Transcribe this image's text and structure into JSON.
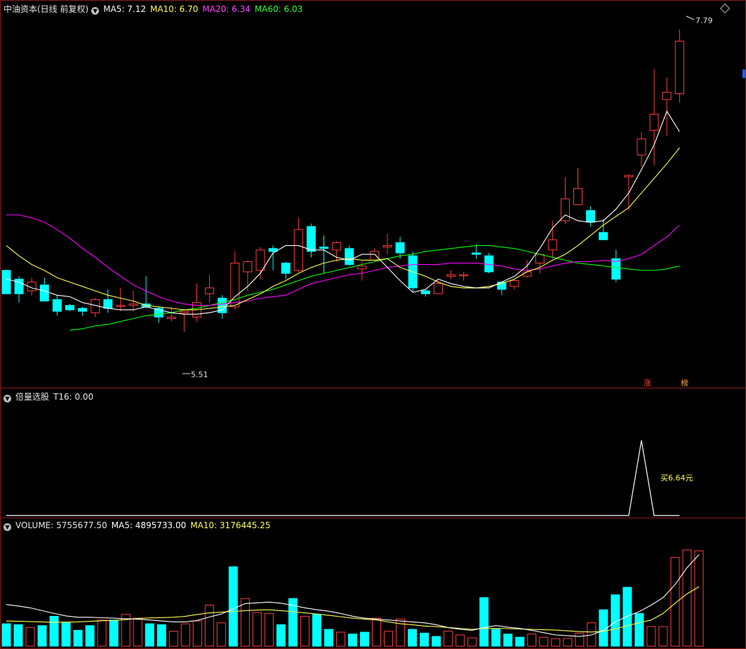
{
  "main_header": {
    "title": "中油资本(日线 前复权)",
    "ma5": "MA5: 7.12",
    "ma10": "MA10: 6.70",
    "ma20": "MA20: 6.34",
    "ma60": "MA60: 6.03"
  },
  "main_labels": {
    "high_label": "7.79",
    "low_label": "5.51",
    "tag_zhang": "涨",
    "tag_bang": "榜",
    "corner_icon": "diamond-icon"
  },
  "ind_header": {
    "title": "倍量选股",
    "t16": "T16: 0.00"
  },
  "ind_labels": {
    "buy_label": "买6.64元"
  },
  "vol_header": {
    "volume": "VOLUME: 5755677.50",
    "ma5": "MA5: 4895733.00",
    "ma10": "MA10: 3176445.25"
  },
  "colors": {
    "up": "#ff3c3c",
    "down": "#00ffff",
    "ma5": "#ffffff",
    "ma10": "#ffff50",
    "ma20": "#ff00ff",
    "ma60": "#00ff00",
    "border": "#8a1a1a"
  },
  "chart_data": [
    {
      "type": "candlestick",
      "title": "中油资本(日线 前复权)",
      "ylim": [
        5.4,
        7.95
      ],
      "candles": [
        [
          6.17,
          6.01,
          6.16,
          6.02
        ],
        [
          6.11,
          6.01,
          6.13,
          5.95
        ],
        [
          6.03,
          6.09,
          6.12,
          6.0
        ],
        [
          6.07,
          5.96,
          6.12,
          5.96
        ],
        [
          5.97,
          5.89,
          6.0,
          5.86
        ],
        [
          5.93,
          5.9,
          5.94,
          5.89
        ],
        [
          5.91,
          5.89,
          5.92,
          5.86
        ],
        [
          5.88,
          5.97,
          5.98,
          5.85
        ],
        [
          5.97,
          5.91,
          6.04,
          5.88
        ],
        [
          5.93,
          5.93,
          6.05,
          5.89
        ],
        [
          5.93,
          5.94,
          6.03,
          5.89
        ],
        [
          5.94,
          5.92,
          6.13,
          5.91
        ],
        [
          5.91,
          5.85,
          5.92,
          5.81
        ],
        [
          5.84,
          5.85,
          5.92,
          5.82
        ],
        [
          5.88,
          5.89,
          5.9,
          5.75
        ],
        [
          5.85,
          5.95,
          6.08,
          5.82
        ],
        [
          6.01,
          6.05,
          6.14,
          5.95
        ],
        [
          5.98,
          5.88,
          6.0,
          5.84
        ],
        [
          5.92,
          6.22,
          6.3,
          5.9
        ],
        [
          6.16,
          6.23,
          6.24,
          6.03
        ],
        [
          6.17,
          6.31,
          6.33,
          6.11
        ],
        [
          6.32,
          6.3,
          6.34,
          6.17
        ],
        [
          6.22,
          6.15,
          6.23,
          6.11
        ],
        [
          6.17,
          6.45,
          6.53,
          6.16
        ],
        [
          6.47,
          6.3,
          6.49,
          6.26
        ],
        [
          6.33,
          6.32,
          6.41,
          6.15
        ],
        [
          6.31,
          6.36,
          6.37,
          6.23
        ],
        [
          6.32,
          6.21,
          6.34,
          6.2
        ],
        [
          6.18,
          6.2,
          6.23,
          6.1
        ],
        [
          6.24,
          6.3,
          6.32,
          6.23
        ],
        [
          6.33,
          6.34,
          6.42,
          6.28
        ],
        [
          6.36,
          6.29,
          6.4,
          6.25
        ],
        [
          6.27,
          6.05,
          6.3,
          6.02
        ],
        [
          6.03,
          6.01,
          6.04,
          5.99
        ],
        [
          6.01,
          6.08,
          6.1,
          6.01
        ],
        [
          6.13,
          6.14,
          6.17,
          6.11
        ],
        [
          6.14,
          6.14,
          6.16,
          6.1
        ],
        [
          6.29,
          6.28,
          6.35,
          6.25
        ],
        [
          6.27,
          6.16,
          6.29,
          6.15
        ],
        [
          6.09,
          6.04,
          6.09,
          6.0
        ],
        [
          6.06,
          6.1,
          6.11,
          6.04
        ],
        [
          6.13,
          6.16,
          6.24,
          6.12
        ],
        [
          6.22,
          6.28,
          6.28,
          6.15
        ],
        [
          6.31,
          6.38,
          6.51,
          6.25
        ],
        [
          6.51,
          6.66,
          6.81,
          6.49
        ],
        [
          6.62,
          6.73,
          6.87,
          6.62
        ],
        [
          6.58,
          6.5,
          6.61,
          6.47
        ],
        [
          6.43,
          6.38,
          6.52,
          6.4
        ],
        [
          6.25,
          6.11,
          6.31,
          6.09
        ],
        [
          6.81,
          6.82,
          6.83,
          6.58
        ],
        [
          6.96,
          7.07,
          7.12,
          6.88
        ],
        [
          7.13,
          7.24,
          7.55,
          6.89
        ],
        [
          7.34,
          7.39,
          7.49,
          7.09
        ],
        [
          7.38,
          7.74,
          7.82,
          7.32
        ]
      ],
      "ma5": [
        6.11,
        6.09,
        6.05,
        6.03,
        6.0,
        5.99,
        5.95,
        5.93,
        5.91,
        5.9,
        5.9,
        5.92,
        5.9,
        5.88,
        5.87,
        5.87,
        5.88,
        5.9,
        5.99,
        6.06,
        6.15,
        6.29,
        6.34,
        6.34,
        6.31,
        6.31,
        6.26,
        6.24,
        6.28,
        6.28,
        6.19,
        6.1,
        6.02,
        6.04,
        6.11,
        6.08,
        6.06,
        6.05,
        6.05,
        6.09,
        6.13,
        6.2,
        6.32,
        6.46,
        6.55,
        6.51,
        6.5,
        6.51,
        6.59,
        6.7,
        6.86,
        7.03,
        7.26,
        7.12
      ],
      "ma10": [
        6.34,
        6.27,
        6.21,
        6.17,
        6.12,
        6.09,
        6.06,
        6.03,
        6.0,
        5.98,
        5.96,
        5.93,
        5.92,
        5.91,
        5.9,
        5.9,
        5.91,
        5.92,
        5.93,
        5.97,
        6.01,
        6.06,
        6.1,
        6.15,
        6.19,
        6.22,
        6.24,
        6.25,
        6.24,
        6.24,
        6.25,
        6.19,
        6.16,
        6.13,
        6.09,
        6.06,
        6.05,
        6.05,
        6.06,
        6.08,
        6.11,
        6.16,
        6.19,
        6.24,
        6.28,
        6.34,
        6.41,
        6.48,
        6.54,
        6.6,
        6.7,
        6.8,
        6.9,
        7.01
      ],
      "ma20": [
        6.55,
        6.55,
        6.53,
        6.5,
        6.45,
        6.39,
        6.32,
        6.26,
        6.19,
        6.13,
        6.07,
        6.03,
        5.99,
        5.96,
        5.94,
        5.93,
        5.93,
        5.94,
        5.95,
        5.96,
        5.98,
        5.99,
        6.0,
        6.04,
        6.08,
        6.1,
        6.12,
        6.14,
        6.15,
        6.17,
        6.19,
        6.2,
        6.21,
        6.21,
        6.21,
        6.22,
        6.22,
        6.22,
        6.21,
        6.2,
        6.18,
        6.17,
        6.18,
        6.2,
        6.22,
        6.23,
        6.23,
        6.24,
        6.23,
        6.25,
        6.28,
        6.34,
        6.4,
        6.48
      ],
      "ma60": [
        null,
        null,
        null,
        null,
        null,
        5.76,
        5.77,
        5.79,
        5.8,
        5.82,
        5.84,
        5.86,
        5.87,
        5.88,
        5.9,
        5.91,
        5.93,
        5.95,
        5.97,
        6.0,
        6.02,
        6.04,
        6.07,
        6.1,
        6.13,
        6.15,
        6.17,
        6.19,
        6.21,
        6.23,
        6.25,
        6.27,
        6.28,
        6.3,
        6.31,
        6.32,
        6.33,
        6.34,
        6.34,
        6.33,
        6.32,
        6.3,
        6.28,
        6.26,
        6.24,
        6.22,
        6.21,
        6.2,
        6.19,
        6.18,
        6.17,
        6.17,
        6.18,
        6.2
      ]
    },
    {
      "type": "line",
      "title": "倍量选股",
      "ylim": [
        0,
        1
      ],
      "values": [
        0,
        0,
        0,
        0,
        0,
        0,
        0,
        0,
        0,
        0,
        0,
        0,
        0,
        0,
        0,
        0,
        0,
        0,
        0,
        0,
        0,
        0,
        0,
        0,
        0,
        0,
        0,
        0,
        0,
        0,
        0,
        0,
        0,
        0,
        0,
        0,
        0,
        0,
        0,
        0,
        0,
        0,
        0,
        0,
        0,
        0,
        0,
        0,
        0,
        0,
        1,
        0,
        0,
        0
      ]
    },
    {
      "type": "bar",
      "title": "VOLUME",
      "ylim": [
        0,
        6200000
      ],
      "volumes": [
        1200000,
        1150000,
        1000000,
        1100000,
        1600000,
        1250000,
        850000,
        1100000,
        1400000,
        1400000,
        1700000,
        1500000,
        1200000,
        1150000,
        800000,
        1200000,
        1350000,
        2200000,
        1250000,
        4250000,
        2550000,
        1800000,
        1750000,
        1150000,
        2550000,
        1600000,
        1700000,
        900000,
        750000,
        650000,
        750000,
        1500000,
        800000,
        1450000,
        900000,
        700000,
        520000,
        800000,
        600000,
        450000,
        2600000,
        900000,
        650000,
        480000,
        650000,
        480000,
        400000,
        420000,
        700000,
        1250000,
        1950000,
        2750000,
        3150000,
        1750000,
        1050000,
        1050000,
        4750000,
        5150000,
        5100000
      ],
      "ma5": [
        2230000,
        2150000,
        2050000,
        1900000,
        1750000,
        1620000,
        1550000,
        1550000,
        1520000,
        1500000,
        1470000,
        1450000,
        1400000,
        1350000,
        1300000,
        1300000,
        1380000,
        1560000,
        1720000,
        2000000,
        2280000,
        2320000,
        2360000,
        2300000,
        2180000,
        2050000,
        1950000,
        1870000,
        1750000,
        1600000,
        1500000,
        1450000,
        1400000,
        1350000,
        1300000,
        1250000,
        1150000,
        1000000,
        900000,
        850000,
        1000000,
        1100000,
        1020000,
        950000,
        850000,
        720000,
        600000,
        560000,
        520000,
        600000,
        850000,
        1300000,
        1600000,
        1850000,
        2200000,
        2600000,
        3300000,
        4200000,
        4900000
      ],
      "ma10": [
        1350000,
        1330000,
        1320000,
        1300000,
        1280000,
        1290000,
        1300000,
        1330000,
        1360000,
        1380000,
        1420000,
        1480000,
        1510000,
        1530000,
        1550000,
        1600000,
        1700000,
        1780000,
        1820000,
        1860000,
        1900000,
        1930000,
        1950000,
        1900000,
        1850000,
        1780000,
        1720000,
        1650000,
        1580000,
        1500000,
        1450000,
        1400000,
        1300000,
        1200000,
        1150000,
        1080000,
        1050000,
        1000000,
        950000,
        900000,
        950000,
        950000,
        940000,
        920000,
        900000,
        880000,
        860000,
        820000,
        780000,
        760000,
        800000,
        920000,
        1100000,
        1250000,
        1400000,
        1750000,
        2300000,
        2800000,
        3180000
      ]
    }
  ]
}
